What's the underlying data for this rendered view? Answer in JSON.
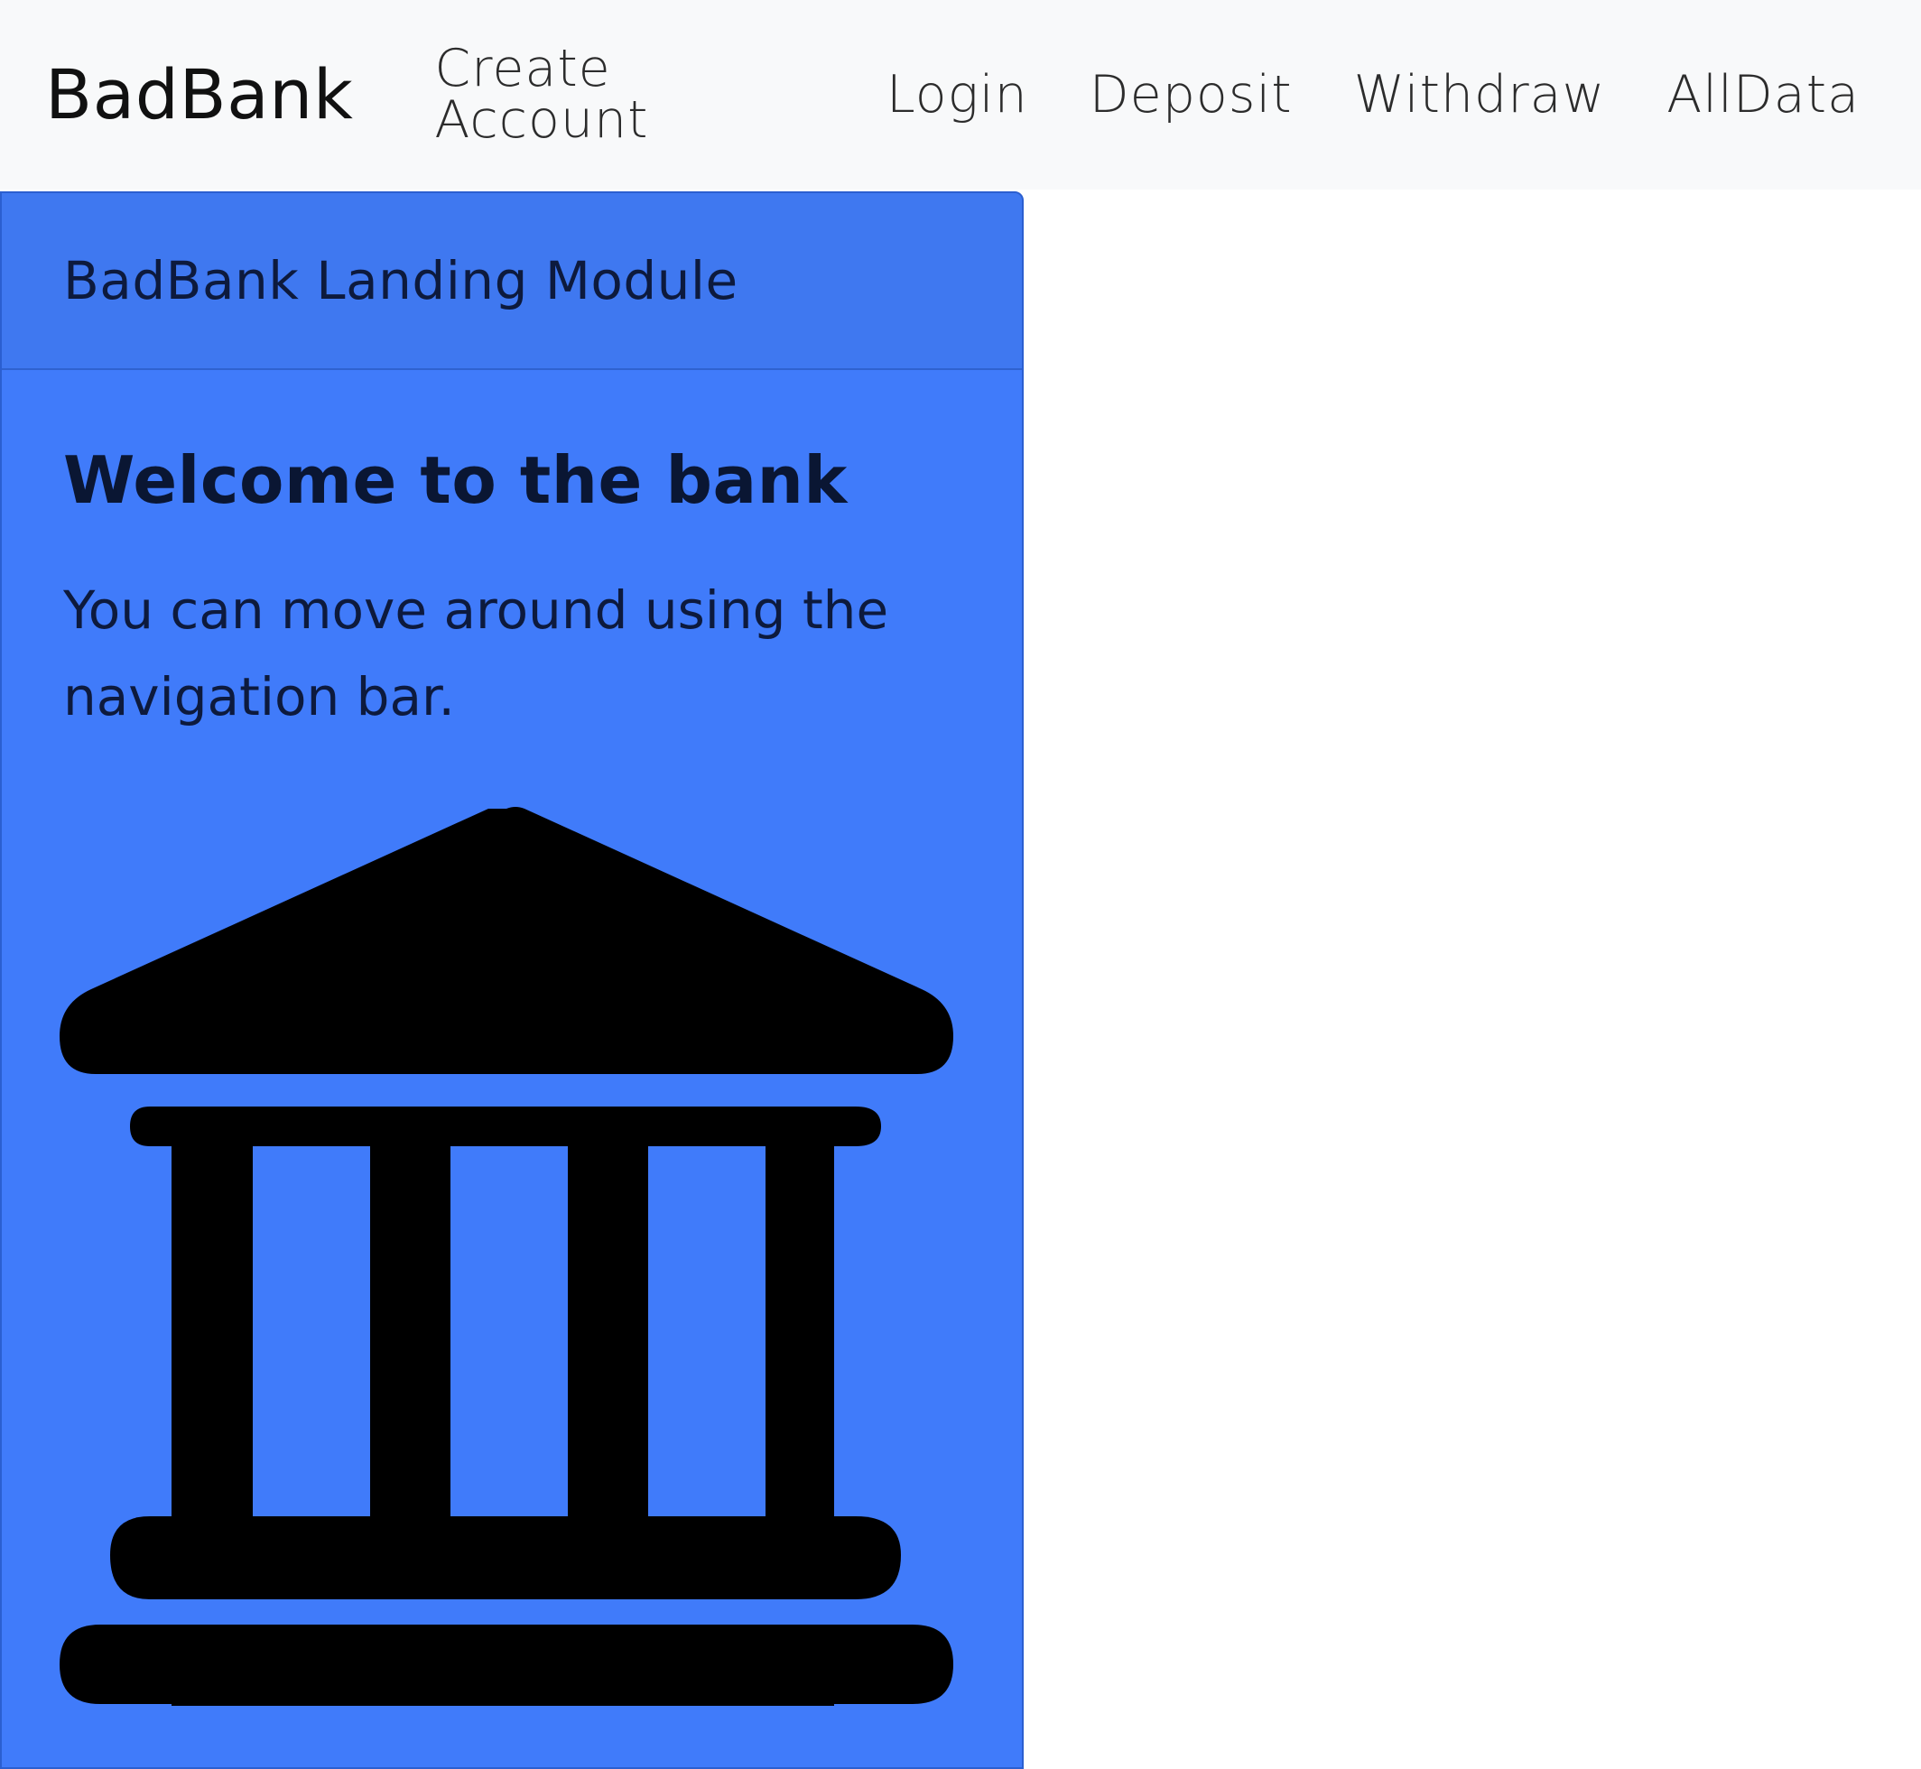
{
  "navbar": {
    "brand": "BadBank",
    "links": [
      {
        "label": "Create Account"
      },
      {
        "label": "Login"
      },
      {
        "label": "Deposit"
      },
      {
        "label": "Withdraw"
      },
      {
        "label": "AllData"
      }
    ]
  },
  "card": {
    "header": "BadBank Landing Module",
    "title": "Welcome to the bank",
    "text": "You can move around using the navigation bar.",
    "image_icon": "bank-building-icon",
    "background_color": "#407bfa"
  }
}
